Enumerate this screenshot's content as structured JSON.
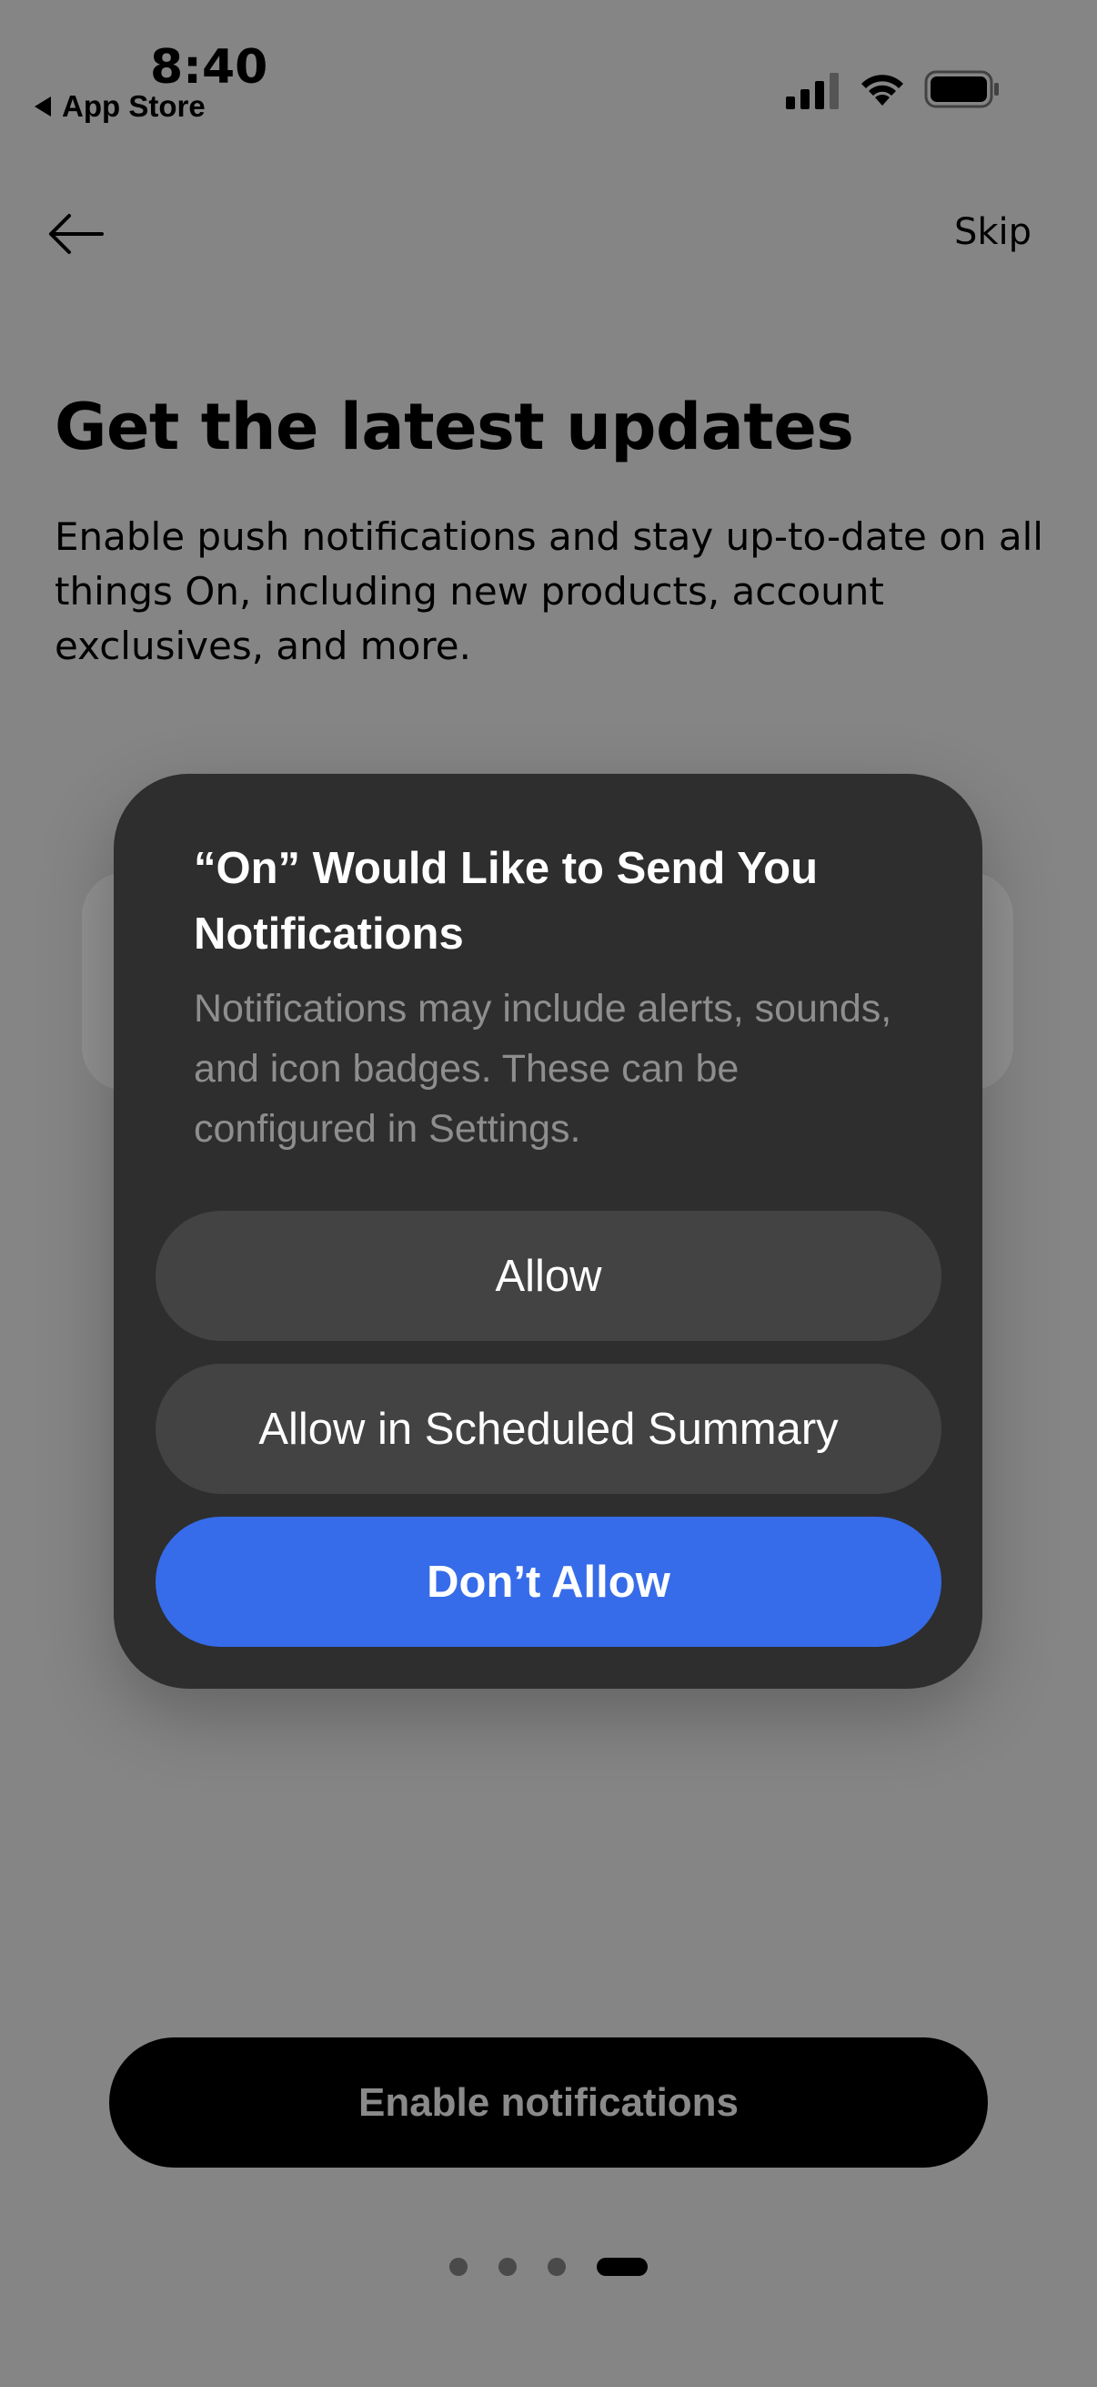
{
  "status_bar": {
    "time": "8:40",
    "back_app": "App Store"
  },
  "nav": {
    "back_icon": "arrow-left-icon",
    "skip_label": "Skip"
  },
  "content": {
    "title": "Get the latest updates",
    "subtitle": "Enable push notifications and stay up-to-date on all things On, including new products, account exclusives, and more."
  },
  "alert": {
    "title": "“On” Would Like to Send You Notifications",
    "message": "Notifications may include alerts, sounds, and icon badges. These can be configured in Settings.",
    "buttons": {
      "allow": "Allow",
      "scheduled": "Allow in Scheduled Summary",
      "dont_allow": "Don’t Allow"
    },
    "accent_color": "#366CE9"
  },
  "cta": {
    "label": "Enable notifications"
  },
  "pager": {
    "total": 4,
    "current": 4
  }
}
